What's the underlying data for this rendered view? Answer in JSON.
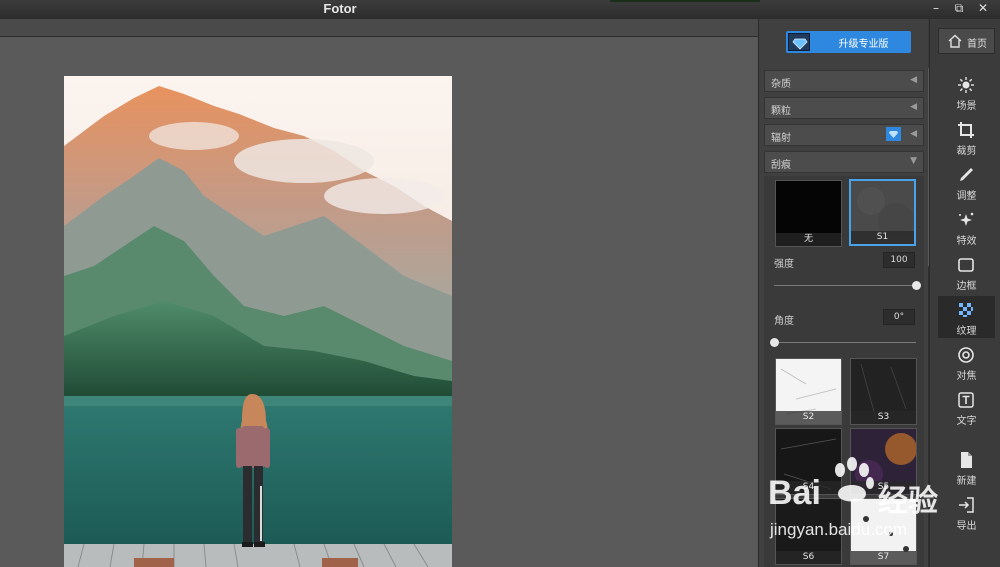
{
  "window": {
    "title": "Fotor",
    "controls": {
      "minimize": "–",
      "restore": "⧉",
      "close": "✕"
    }
  },
  "panel": {
    "upgrade_label": "升级专业版",
    "sections": [
      {
        "label": "杂质",
        "arrow": "◀"
      },
      {
        "label": "颗粒",
        "arrow": "◀"
      },
      {
        "label": "辐射",
        "arrow": "◀"
      },
      {
        "label": "刮痕",
        "arrow": "▼"
      }
    ],
    "thumbnails_top": [
      {
        "label": "无"
      },
      {
        "label": "S1"
      }
    ],
    "strength": {
      "label": "强度",
      "value": "100",
      "level": 1.0
    },
    "angle": {
      "label": "角度",
      "value": "0°",
      "level": 0.0
    },
    "thumbnails": [
      {
        "label": "S2"
      },
      {
        "label": "S3"
      },
      {
        "label": "S4"
      },
      {
        "label": "S5"
      },
      {
        "label": "S6"
      },
      {
        "label": "S7"
      }
    ]
  },
  "tools": {
    "home_label": "首页",
    "items": [
      {
        "label": "场景",
        "icon": "scene-icon"
      },
      {
        "label": "裁剪",
        "icon": "crop-icon"
      },
      {
        "label": "调整",
        "icon": "brush-icon"
      },
      {
        "label": "特效",
        "icon": "sparkle-icon"
      },
      {
        "label": "边框",
        "icon": "frame-icon"
      },
      {
        "label": "纹理",
        "icon": "texture-icon"
      },
      {
        "label": "对焦",
        "icon": "focus-icon"
      },
      {
        "label": "文字",
        "icon": "text-icon"
      },
      {
        "label": "新建",
        "icon": "new-file-icon"
      },
      {
        "label": "导出",
        "icon": "export-icon"
      }
    ]
  },
  "watermark": {
    "brand": "Bai",
    "brand2": "经验",
    "url": "jingyan.baidu.com"
  },
  "colors": {
    "accent": "#2f88e0",
    "selected_border": "#4aa3e8",
    "canvas_bg": "#5a5a5a"
  }
}
